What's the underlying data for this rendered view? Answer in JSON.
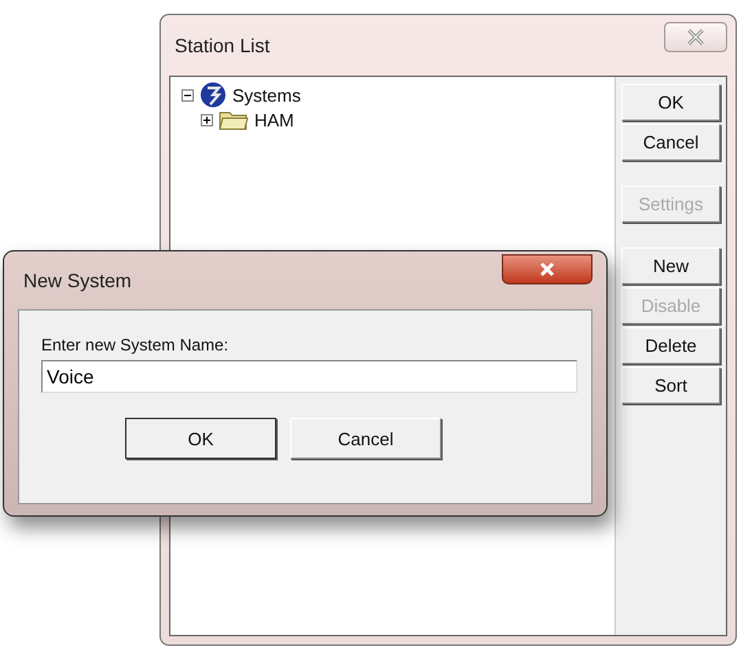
{
  "window": {
    "title": "Station List"
  },
  "tree": [
    {
      "label": "Systems",
      "kind": "globe",
      "expanded": true,
      "children": [
        {
          "label": "HAM",
          "kind": "folder",
          "expanded": false
        }
      ]
    }
  ],
  "button_groups": [
    [
      {
        "label": "OK",
        "disabled": false
      },
      {
        "label": "Cancel",
        "disabled": false
      }
    ],
    [
      {
        "label": "Settings",
        "disabled": true
      }
    ],
    [
      {
        "label": "New",
        "disabled": false
      },
      {
        "label": "Disable",
        "disabled": true
      },
      {
        "label": "Delete",
        "disabled": false
      },
      {
        "label": "Sort",
        "disabled": false
      }
    ]
  ],
  "dialog": {
    "title": "New System",
    "prompt": "Enter new System Name:",
    "value": "Voice",
    "buttons": [
      "OK",
      "Cancel"
    ]
  }
}
